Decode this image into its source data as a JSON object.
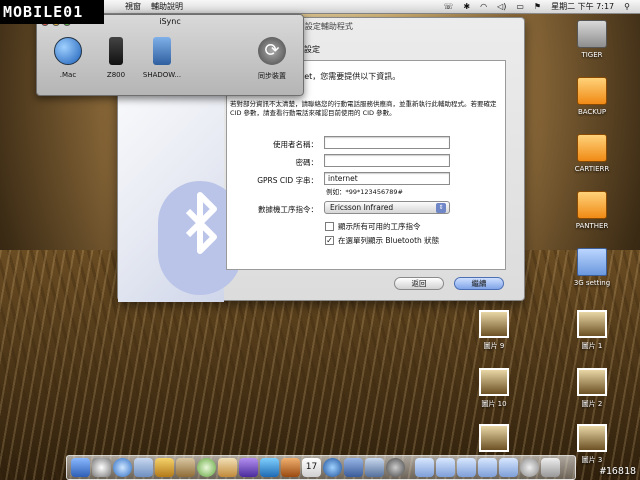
{
  "menubar": {
    "menus": [
      "視窗",
      "輔助說明"
    ],
    "clock": "星期二 下午 7:17"
  },
  "logo": "MOBILE01",
  "isync": {
    "title": "iSync",
    "devices": [
      {
        "label": ".Mac",
        "icon": "dotmac-globe-icon"
      },
      {
        "label": "Z800",
        "icon": "phone-icon"
      },
      {
        "label": "SHADOW...",
        "icon": "pda-icon"
      }
    ],
    "sync_label": "同步裝置"
  },
  "assistant": {
    "title_fragment": "oth 設定輔助程式",
    "section_fragment": "設定",
    "lead_fragment": "動電話連接 Internet，您需要提供以下資訊。",
    "note": "若對部分資訊不太清楚，請聯絡您的行動電話服務供應商，並重新執行此輔助程式。若要確定 CID 參數，請查看行動電話來確認目前使用的 CID 參數。",
    "fields": {
      "username_label": "使用者名稱：",
      "username_value": "",
      "password_label": "密碼：",
      "password_value": "",
      "gprs_label": "GPRS CID 字串：",
      "gprs_value": "internet",
      "gprs_example": "例如：*99*123456789#"
    },
    "modem_label": "數據機工序指令：",
    "modem_selected": "Ericsson Infrared",
    "checkbox_show_all": "顯示所有可用的工序指令",
    "checkbox_show_all_checked": false,
    "checkbox_menubar": "在選單列顯示 Bluetooth 狀態",
    "checkbox_menubar_checked": true,
    "back_button": "返回",
    "continue_button": "繼續"
  },
  "desktop_icons": [
    "TIGER",
    "BACKUP",
    "CARTIERR",
    "PANTHER",
    "3G setting",
    "圖片 9",
    "圖片 1",
    "圖片 10",
    "圖片 2",
    "圖片 3"
  ],
  "watermark": "#16818"
}
